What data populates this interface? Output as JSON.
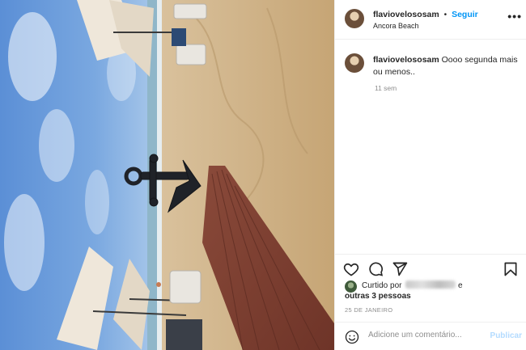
{
  "post": {
    "username": "flaviovelososam",
    "separator": "•",
    "follow_label": "Seguir",
    "location": "Ancora Beach",
    "more_label": "•••"
  },
  "caption": {
    "username": "flaviovelososam",
    "text": "Oooo segunda mais ou menos..",
    "time": "11 sem"
  },
  "actions": {
    "like_icon": "heart-icon",
    "comment_icon": "comment-icon",
    "share_icon": "paper-plane-icon",
    "save_icon": "bookmark-icon"
  },
  "likes": {
    "prefix": "Curtido por",
    "conjunction": "e",
    "others": "outras 3 pessoas"
  },
  "date": "25 DE JANEIRO",
  "comment": {
    "placeholder": "Adicione um comentário...",
    "publish_label": "Publicar"
  },
  "colors": {
    "accent": "#0095f6",
    "publish_disabled": "#b3dbff",
    "muted": "#8e8e8e",
    "text": "#262626",
    "border": "#efefef"
  }
}
